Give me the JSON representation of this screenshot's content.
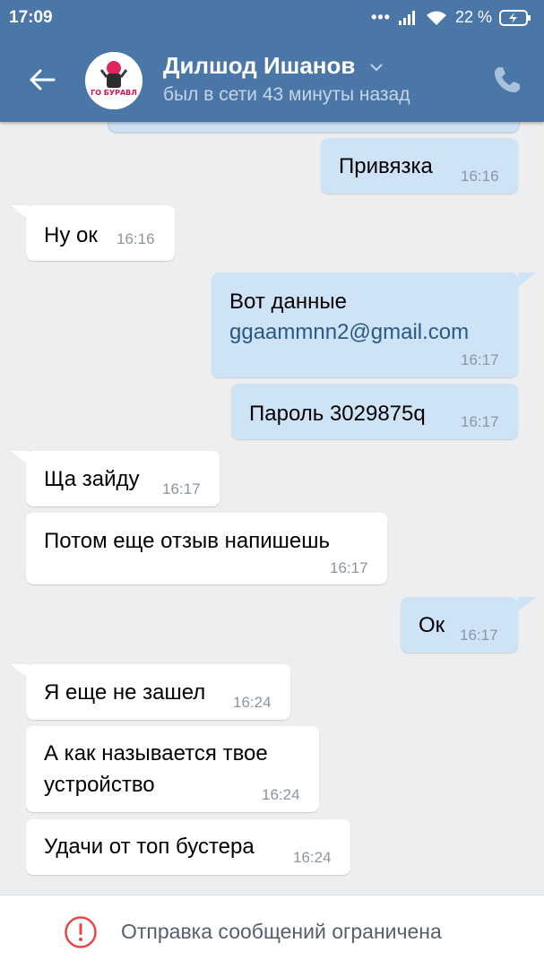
{
  "status_bar": {
    "time": "17:09",
    "battery_percent": "22 %"
  },
  "header": {
    "contact_name": "Дилшод Ишанов",
    "last_seen": "был в сети 43 минуты назад",
    "avatar_caption": "ГО БУРАВЛ"
  },
  "messages": [
    {
      "dir": "out",
      "text": "Привязка",
      "time": "16:16"
    },
    {
      "dir": "in",
      "text": "Ну ок",
      "time": "16:16"
    },
    {
      "dir": "out",
      "text": "Вот данные",
      "link": "ggaammnn2@gmail.com",
      "time": "16:17"
    },
    {
      "dir": "out",
      "text": "Пароль 3029875q",
      "time": "16:17"
    },
    {
      "dir": "in",
      "text": "Ща зайду",
      "time": "16:17"
    },
    {
      "dir": "in",
      "text": "Потом еще отзыв напишешь",
      "time": "16:17"
    },
    {
      "dir": "out",
      "text": "Ок",
      "time": "16:17"
    },
    {
      "dir": "in",
      "text": "Я еще не зашел",
      "time": "16:24"
    },
    {
      "dir": "in",
      "text_line1": "А как называется твое",
      "text_line2": "устройство",
      "time": "16:24"
    },
    {
      "dir": "in",
      "text": "Удачи от топ бустера",
      "time": "16:24"
    }
  ],
  "footer": {
    "notice": "Отправка сообщений ограничена"
  },
  "colors": {
    "header": "#4a76a8",
    "outgoing": "#cfe3f7",
    "incoming": "#ffffff",
    "background": "#edeef0",
    "warning": "#e64646"
  }
}
